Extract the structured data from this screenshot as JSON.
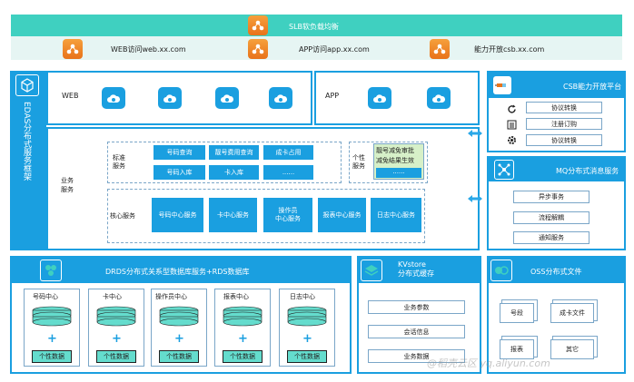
{
  "slb": {
    "label": "SLB软负载均衡"
  },
  "access": [
    {
      "label": "WEB访问web.xx.com"
    },
    {
      "label": "APP访问app.xx.com"
    },
    {
      "label": "能力开放csb.xx.com"
    }
  ],
  "edas": {
    "label": "EDAS分布式服务框架"
  },
  "web": {
    "label": "WEB"
  },
  "app": {
    "label": "APP"
  },
  "business": {
    "label": "业务\n服务",
    "standard": {
      "label": "标准\n服务",
      "items": [
        "号码查询",
        "靓号费用查询",
        "成卡占用",
        "号码入库",
        "卡入库",
        "......"
      ]
    },
    "personal": {
      "label": "个性\n服务",
      "items": [
        "靓号减免审批",
        "减免结果生效",
        "......"
      ]
    },
    "core": {
      "label": "核心服务",
      "items": [
        "号码中心服务",
        "卡中心服务",
        "操作员\n中心服务",
        "报表中心服务",
        "日志中心服务"
      ]
    }
  },
  "csb": {
    "title": "CSB能力开放平台",
    "items": [
      "协议转换",
      "注册订购",
      "协议转换"
    ]
  },
  "mq": {
    "title": "MQ分布式消息服务",
    "items": [
      "异步事务",
      "流程解耦",
      "通知服务"
    ]
  },
  "drds": {
    "title": "DRDS分布式关系型数据库服务+RDS数据库",
    "centers": [
      "号码中心",
      "卡中心",
      "操作员中心",
      "报表中心",
      "日志中心"
    ],
    "plus": "+",
    "data_label": "个性数据"
  },
  "kv": {
    "title": "KVstore\n分布式缓存",
    "items": [
      "业务参数",
      "会话信息",
      "业务数据"
    ]
  },
  "oss": {
    "title": "OSS分布式文件",
    "items": [
      "号段",
      "成卡文件",
      "报表",
      "其它"
    ]
  },
  "watermark": "@稻壳云区 yq.aliyun.com"
}
